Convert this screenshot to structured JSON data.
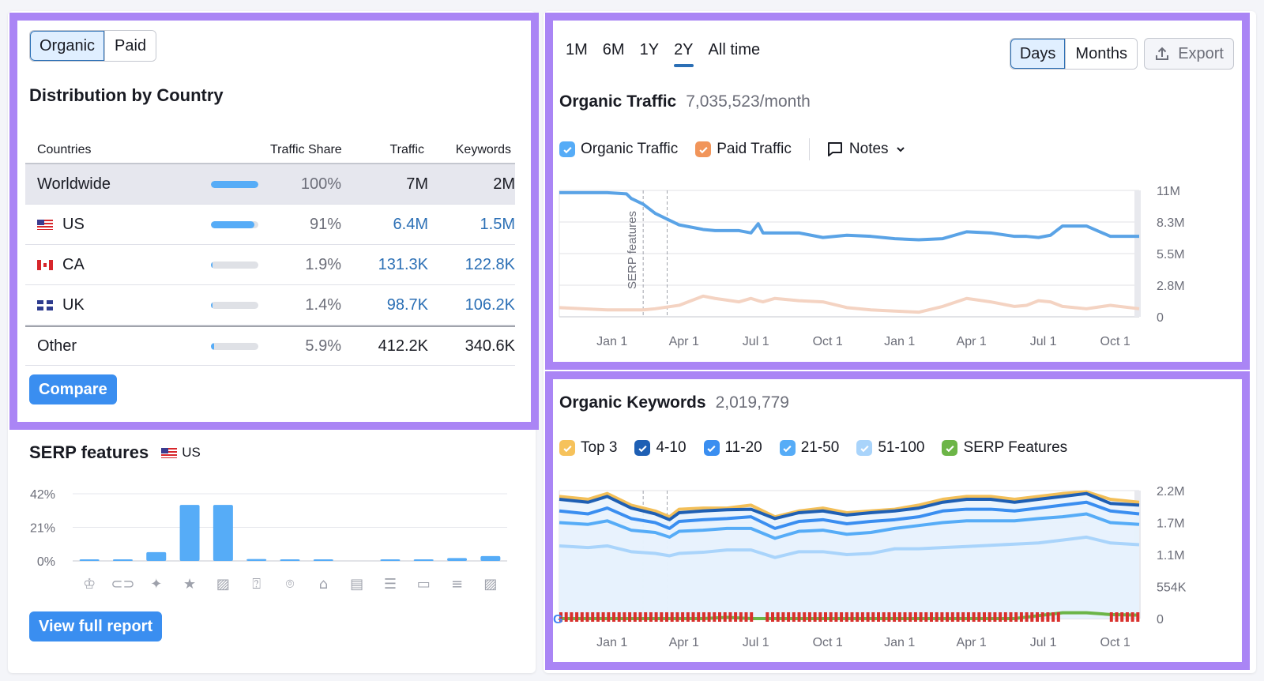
{
  "country_panel": {
    "toggle": [
      {
        "label": "Organic",
        "active": true
      },
      {
        "label": "Paid",
        "active": false
      }
    ],
    "title": "Distribution by Country",
    "columns": {
      "country": "Countries",
      "share": "Traffic Share",
      "traffic": "Traffic",
      "keywords": "Keywords"
    },
    "rows": [
      {
        "name": "Worldwide",
        "flag": "",
        "share": "100%",
        "share_fraction": 1.0,
        "traffic": "7M",
        "keywords": "2M",
        "linked": false
      },
      {
        "name": "US",
        "flag": "us-flag",
        "share": "91%",
        "share_fraction": 0.91,
        "traffic": "6.4M",
        "keywords": "1.5M",
        "linked": true
      },
      {
        "name": "CA",
        "flag": "ca-flag",
        "share": "1.9%",
        "share_fraction": 0.019,
        "traffic": "131.3K",
        "keywords": "122.8K",
        "linked": true
      },
      {
        "name": "UK",
        "flag": "uk-flag",
        "share": "1.4%",
        "share_fraction": 0.014,
        "traffic": "98.7K",
        "keywords": "106.2K",
        "linked": true
      },
      {
        "name": "Other",
        "flag": "",
        "share": "5.9%",
        "share_fraction": 0.059,
        "traffic": "412.2K",
        "keywords": "340.6K",
        "linked": false
      }
    ],
    "compare_label": "Compare"
  },
  "serp_panel": {
    "title": "SERP features",
    "country": "US",
    "button_label": "View full report"
  },
  "traffic_panel": {
    "ranges": [
      {
        "label": "1M",
        "active": false
      },
      {
        "label": "6M",
        "active": false
      },
      {
        "label": "1Y",
        "active": false
      },
      {
        "label": "2Y",
        "active": true
      },
      {
        "label": "All time",
        "active": false
      }
    ],
    "granularity": [
      {
        "label": "Days",
        "active": true
      },
      {
        "label": "Months",
        "active": false
      }
    ],
    "export_label": "Export",
    "title": "Organic Traffic",
    "value": "7,035,523/month",
    "legend": [
      {
        "label": "Organic Traffic",
        "color": "#56acf7",
        "checked": true
      },
      {
        "label": "Paid Traffic",
        "color": "#f1955a",
        "checked": true
      }
    ],
    "notes_label": "Notes",
    "annotation_label": "SERP features"
  },
  "keywords_panel": {
    "title": "Organic Keywords",
    "value": "2,019,779",
    "legend": [
      {
        "label": "Top 3",
        "color": "#f6c25b",
        "checked": true
      },
      {
        "label": "4-10",
        "color": "#1e5fb4",
        "checked": true
      },
      {
        "label": "11-20",
        "color": "#3a8ef0",
        "checked": true
      },
      {
        "label": "21-50",
        "color": "#56acf7",
        "checked": true
      },
      {
        "label": "51-100",
        "color": "#a9d4fb",
        "checked": true
      },
      {
        "label": "SERP Features",
        "color": "#6cb547",
        "checked": true
      }
    ]
  },
  "chart_data": [
    {
      "id": "serp-features",
      "type": "bar",
      "title": "SERP features",
      "categories": [
        "featured-snippet",
        "sitelinks",
        "ai-overview",
        "reviews",
        "image",
        "people-also-ask",
        "local-pack",
        "knowledge-panel",
        "top-stories",
        "things-to-know",
        "discussions",
        "related-searches",
        "image-pack"
      ],
      "values": [
        0.8,
        0.8,
        5.5,
        35,
        35,
        1.2,
        0.8,
        0.8,
        0,
        0.8,
        0.8,
        1.8,
        3
      ],
      "yticks": [
        "0%",
        "21%",
        "42%"
      ],
      "ylim": [
        0,
        42
      ],
      "color": "#56acf7"
    },
    {
      "id": "organic-traffic",
      "type": "line",
      "title": "Organic Traffic",
      "xticks": [
        "Jan 1",
        "Apr 1",
        "Jul 1",
        "Oct 1",
        "Jan 1",
        "Apr 1",
        "Jul 1",
        "Oct 1"
      ],
      "yticks": [
        "0",
        "2.8M",
        "5.5M",
        "8.3M",
        "11M"
      ],
      "ylim": [
        0,
        11000000
      ],
      "x_months": [
        0,
        2,
        2.8,
        3,
        3.5,
        4,
        5,
        6,
        6.5,
        7.5,
        8,
        8.3,
        8.5,
        9,
        10,
        11,
        12,
        13,
        14,
        15,
        16,
        17,
        18,
        19,
        19.5,
        20,
        20.5,
        21,
        22,
        23,
        24.2
      ],
      "series": [
        {
          "name": "Organic Traffic",
          "color": "#5aa3e6",
          "values": [
            10.8,
            10.8,
            10.7,
            10.3,
            9.8,
            9.0,
            8.0,
            7.6,
            7.5,
            7.5,
            7.3,
            8.1,
            7.3,
            7.3,
            7.3,
            6.9,
            7.1,
            7.0,
            6.8,
            6.7,
            6.8,
            7.4,
            7.3,
            7.0,
            7.0,
            6.9,
            7.1,
            7.9,
            7.9,
            7.0,
            7.0
          ]
        },
        {
          "name": "Paid Traffic",
          "color": "#f4d3c2",
          "values": [
            0.8,
            0.6,
            0.6,
            0.6,
            0.6,
            0.7,
            1.0,
            1.8,
            1.6,
            1.3,
            1.6,
            1.4,
            1.3,
            1.6,
            1.4,
            1.3,
            0.8,
            0.6,
            0.5,
            0.4,
            0.9,
            1.6,
            1.3,
            0.9,
            1.0,
            1.4,
            1.3,
            0.9,
            0.7,
            1.0,
            0.7
          ]
        }
      ],
      "annotations": [
        {
          "label": "SERP features",
          "x_month": 3.5
        },
        {
          "label": "",
          "x_month": 4.5
        }
      ]
    },
    {
      "id": "organic-keywords",
      "type": "area",
      "title": "Organic Keywords",
      "xticks": [
        "Jan 1",
        "Apr 1",
        "Jul 1",
        "Oct 1",
        "Jan 1",
        "Apr 1",
        "Jul 1",
        "Oct 1"
      ],
      "yticks": [
        "0",
        "554K",
        "1.1M",
        "1.7M",
        "2.2M"
      ],
      "ylim": [
        0,
        2200000
      ],
      "x_months": [
        0,
        1.2,
        2,
        3,
        4,
        4.6,
        5,
        6,
        7,
        8,
        9,
        10,
        11,
        12,
        13,
        14,
        15,
        16,
        17,
        18,
        19,
        20,
        21,
        22,
        23,
        24.2
      ],
      "series": [
        {
          "name": "Top 3",
          "color": "#f3bf58",
          "values": [
            2.1,
            2.05,
            2.15,
            1.95,
            1.85,
            1.75,
            1.88,
            1.9,
            1.9,
            1.95,
            1.75,
            1.85,
            1.9,
            1.82,
            1.85,
            1.88,
            1.95,
            2.05,
            2.1,
            2.1,
            2.05,
            2.1,
            2.15,
            2.18,
            2.05,
            2.0
          ]
        },
        {
          "name": "4-10",
          "color": "#1e5fb4",
          "values": [
            2.05,
            2.0,
            2.1,
            1.9,
            1.8,
            1.7,
            1.82,
            1.85,
            1.87,
            1.88,
            1.72,
            1.82,
            1.85,
            1.78,
            1.82,
            1.85,
            1.9,
            2.0,
            2.05,
            2.05,
            2.0,
            2.05,
            2.1,
            2.15,
            1.98,
            1.95
          ]
        },
        {
          "name": "11-20",
          "color": "#3a8ef0",
          "values": [
            1.85,
            1.8,
            1.9,
            1.72,
            1.65,
            1.55,
            1.67,
            1.7,
            1.72,
            1.75,
            1.55,
            1.67,
            1.7,
            1.63,
            1.67,
            1.7,
            1.75,
            1.85,
            1.88,
            1.88,
            1.85,
            1.9,
            1.95,
            2.0,
            1.85,
            1.8
          ]
        },
        {
          "name": "21-50",
          "color": "#56acf7",
          "values": [
            1.65,
            1.62,
            1.68,
            1.52,
            1.48,
            1.4,
            1.5,
            1.52,
            1.55,
            1.55,
            1.38,
            1.5,
            1.52,
            1.45,
            1.48,
            1.55,
            1.6,
            1.65,
            1.68,
            1.68,
            1.68,
            1.72,
            1.75,
            1.8,
            1.65,
            1.62
          ]
        },
        {
          "name": "51-100",
          "color": "#a9d4fb",
          "values": [
            1.25,
            1.22,
            1.25,
            1.15,
            1.12,
            1.08,
            1.12,
            1.14,
            1.18,
            1.18,
            1.05,
            1.15,
            1.15,
            1.1,
            1.12,
            1.2,
            1.2,
            1.22,
            1.24,
            1.26,
            1.28,
            1.3,
            1.35,
            1.4,
            1.3,
            1.27
          ]
        },
        {
          "name": "SERP Features",
          "color": "#6cb547",
          "values": [
            0,
            0,
            0,
            0,
            0,
            0,
            0,
            0,
            0.02,
            0,
            0,
            0,
            0,
            0,
            0,
            0,
            0,
            0,
            0,
            0,
            0,
            0.05,
            0.1,
            0.1,
            0.07,
            0.06
          ]
        }
      ],
      "annotations": [
        {
          "label": "",
          "x_month": 3.5
        },
        {
          "label": "",
          "x_month": 4.5
        }
      ]
    }
  ]
}
